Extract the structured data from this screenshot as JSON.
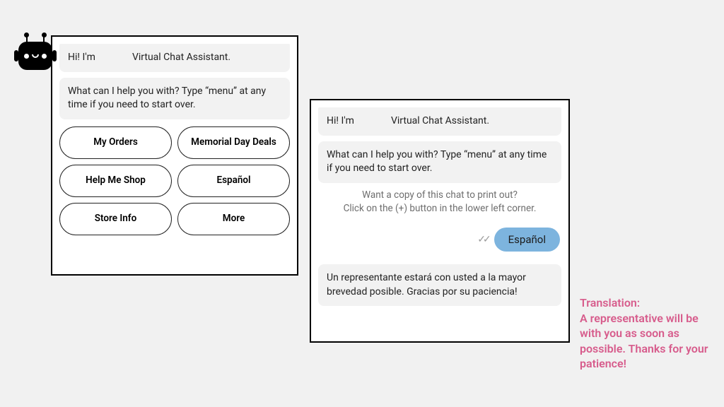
{
  "panel1": {
    "greeting": "Hi! I'm               Virtual Chat Assistant.",
    "prompt": "What can I help you with? Type “menu” at any time if you need to start over.",
    "buttons": [
      "My Orders",
      "Memorial Day Deals",
      "Help Me Shop",
      "Español",
      "Store Info",
      "More"
    ]
  },
  "panel2": {
    "greeting": "Hi! I'm               Virtual Chat Assistant.",
    "prompt": "What can I help you with? Type “menu” at any time if you need to start over.",
    "hint_l1": "Want a copy of this chat to print out?",
    "hint_l2": "Click on the (+) button in the lower left corner.",
    "user_reply": "Español",
    "response": "Un representante estará con usted a la mayor brevedad posible. Gracias por su paciencia!"
  },
  "annotation": {
    "heading": "Translation:",
    "body": "A representative will be with you as soon as possible. Thanks for your patience!"
  }
}
